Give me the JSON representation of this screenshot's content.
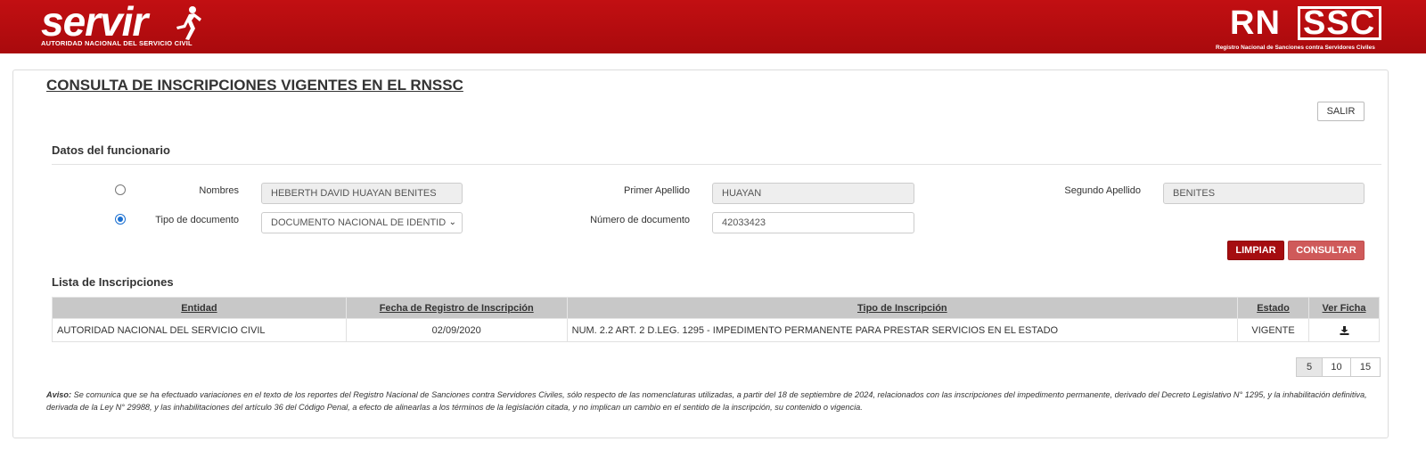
{
  "header": {
    "left_logo_word": "servir",
    "left_logo_sub": "AUTORIDAD NACIONAL DEL SERVICIO CIVIL",
    "right_logo_a": "RN",
    "right_logo_b": "SSC",
    "right_logo_sub": "Registro Nacional de Sanciones contra Servidores Civiles",
    "brand_color": "#b30b0e"
  },
  "page_title": "CONSULTA DE INSCRIPCIONES VIGENTES EN EL RNSSC",
  "buttons": {
    "salir": "SALIR",
    "limpiar": "LIMPIAR",
    "consultar": "CONSULTAR"
  },
  "form": {
    "section_title": "Datos del funcionario",
    "nombres_label": "Nombres",
    "nombres_value": "HEBERTH DAVID HUAYAN BENITES",
    "primer_apellido_label": "Primer Apellido",
    "primer_apellido_value": "HUAYAN",
    "segundo_apellido_label": "Segundo Apellido",
    "segundo_apellido_value": "BENITES",
    "tipo_doc_label": "Tipo de documento",
    "tipo_doc_value": "DOCUMENTO NACIONAL DE IDENTID",
    "num_doc_label": "Número de documento",
    "num_doc_value": "42033423",
    "search_mode_selected": "documento"
  },
  "list": {
    "section_title": "Lista de Inscripciones",
    "columns": [
      "Entidad",
      "Fecha de Registro de Inscripción",
      "Tipo de Inscripción",
      "Estado",
      "Ver Ficha"
    ],
    "rows": [
      {
        "entidad": "AUTORIDAD NACIONAL DEL SERVICIO CIVIL",
        "fecha": "02/09/2020",
        "tipo": "NUM. 2.2 ART. 2 D.LEG. 1295 - IMPEDIMENTO PERMANENTE PARA PRESTAR SERVICIOS EN EL ESTADO",
        "estado": "VIGENTE",
        "ficha_icon": "download-icon"
      }
    ]
  },
  "pagination": {
    "sizes": [
      "5",
      "10",
      "15"
    ],
    "selected": "5"
  },
  "aviso": {
    "label": "Aviso:",
    "text": " Se comunica que se ha efectuado variaciones en el texto de los reportes del Registro Nacional de Sanciones contra Servidores Civiles, sólo respecto de las nomenclaturas utilizadas, a partir del 18 de septiembre de 2024, relacionados con las inscripciones del impedimento permanente, derivado del Decreto Legislativo N° 1295, y la inhabilitación definitiva, derivada de la Ley N° 29988, y las inhabilitaciones del artículo 36 del Código Penal, a efecto de alinearlas a los términos de la legislación citada, y no implican un cambio en el sentido de la inscripción, su contenido o vigencia."
  }
}
